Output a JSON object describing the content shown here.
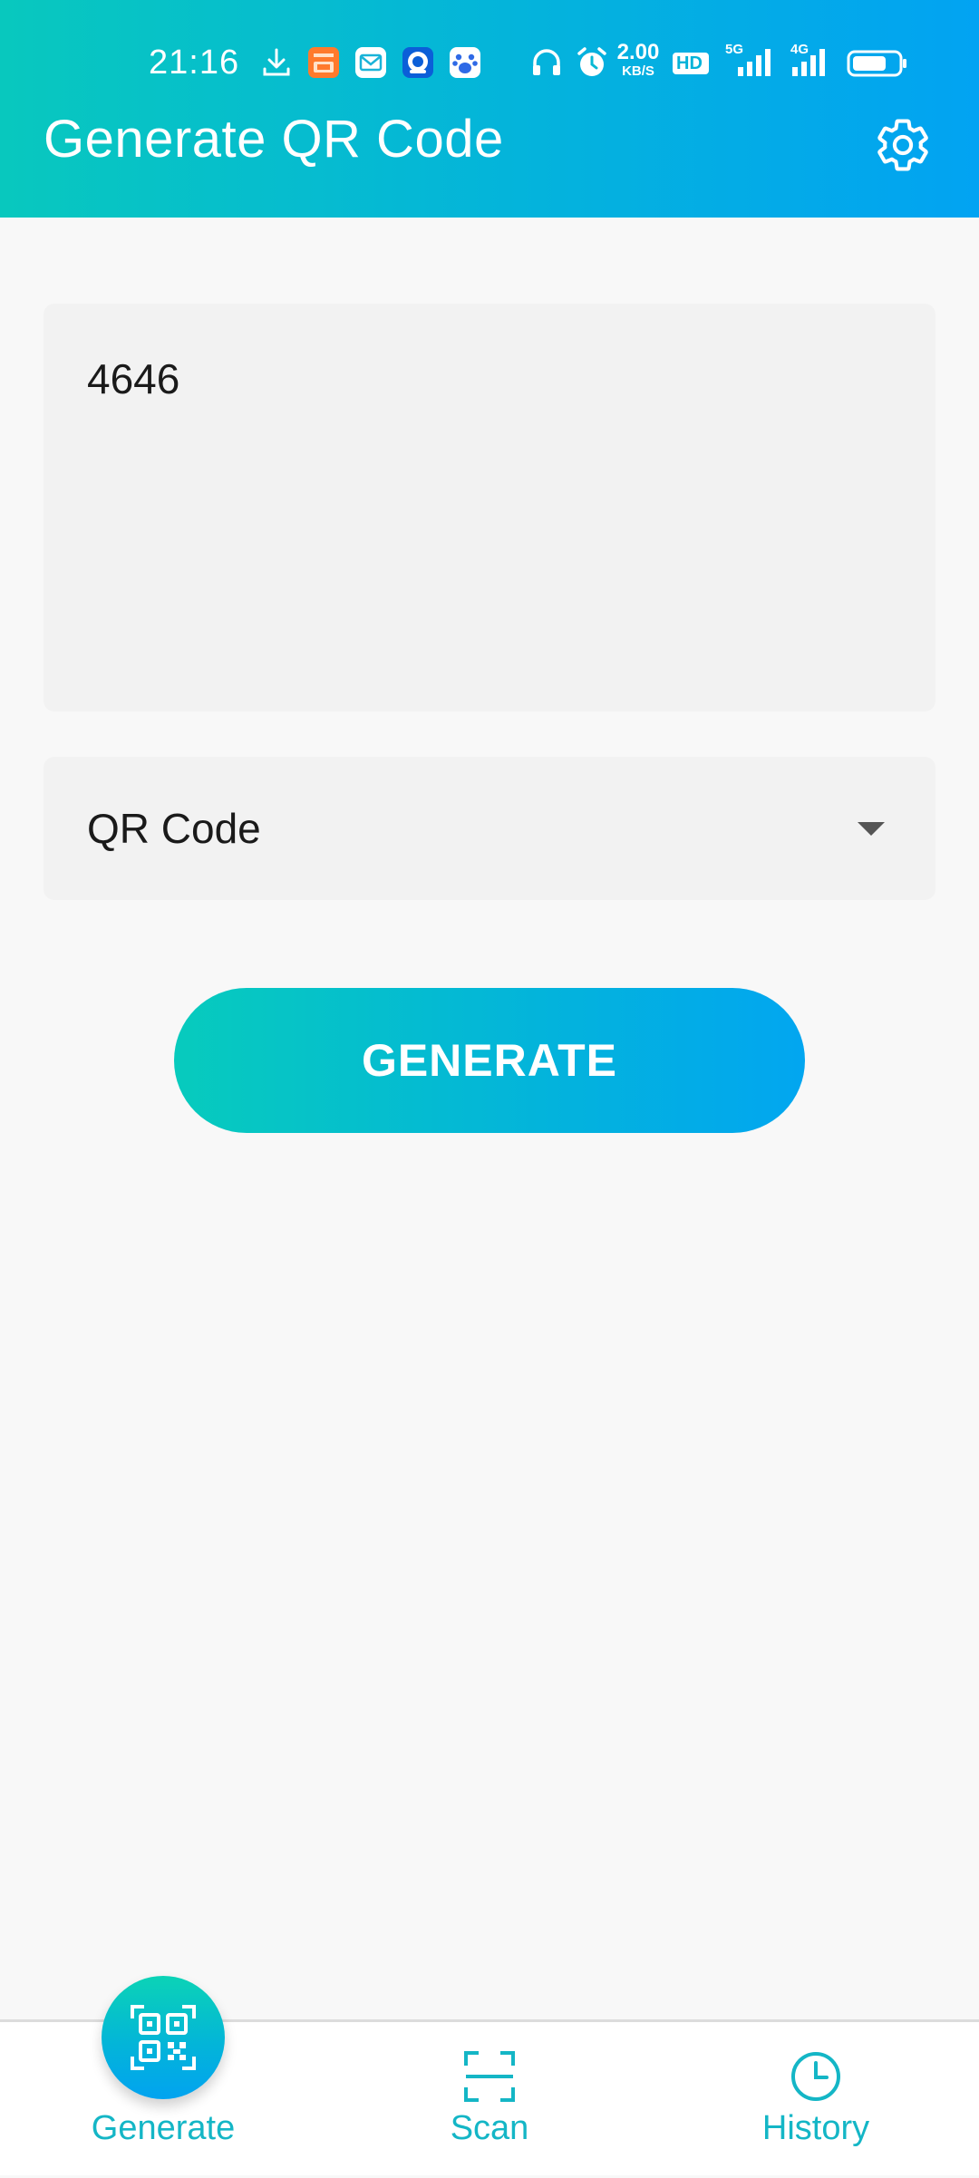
{
  "status_bar": {
    "time": "21:16",
    "net_speed_value": "2.00",
    "net_speed_unit": "KB/S",
    "hd_label": "HD",
    "network_5g_label": "5G",
    "network_4g_label": "4G",
    "icons": [
      "download-icon",
      "app-notification-icon",
      "mail-icon",
      "app-notification-icon",
      "paw-app-icon",
      "headphones-icon",
      "alarm-icon",
      "hd-icon",
      "signal-5g-icon",
      "signal-4g-icon",
      "battery-icon"
    ]
  },
  "header": {
    "title": "Generate QR Code",
    "settings_icon": "gear-icon"
  },
  "form": {
    "text_value": "4646",
    "code_type": "QR Code",
    "generate_label": "GENERATE"
  },
  "bottom_nav": {
    "items": [
      {
        "label": "Generate",
        "icon": "qr-code-icon",
        "active": true
      },
      {
        "label": "Scan",
        "icon": "scan-frame-icon",
        "active": false
      },
      {
        "label": "History",
        "icon": "clock-icon",
        "active": false
      }
    ]
  },
  "colors": {
    "accent_start": "#08c8be",
    "accent_end": "#02a3f2",
    "nav_label": "#14b6c6",
    "field_background": "#f2f2f2"
  }
}
